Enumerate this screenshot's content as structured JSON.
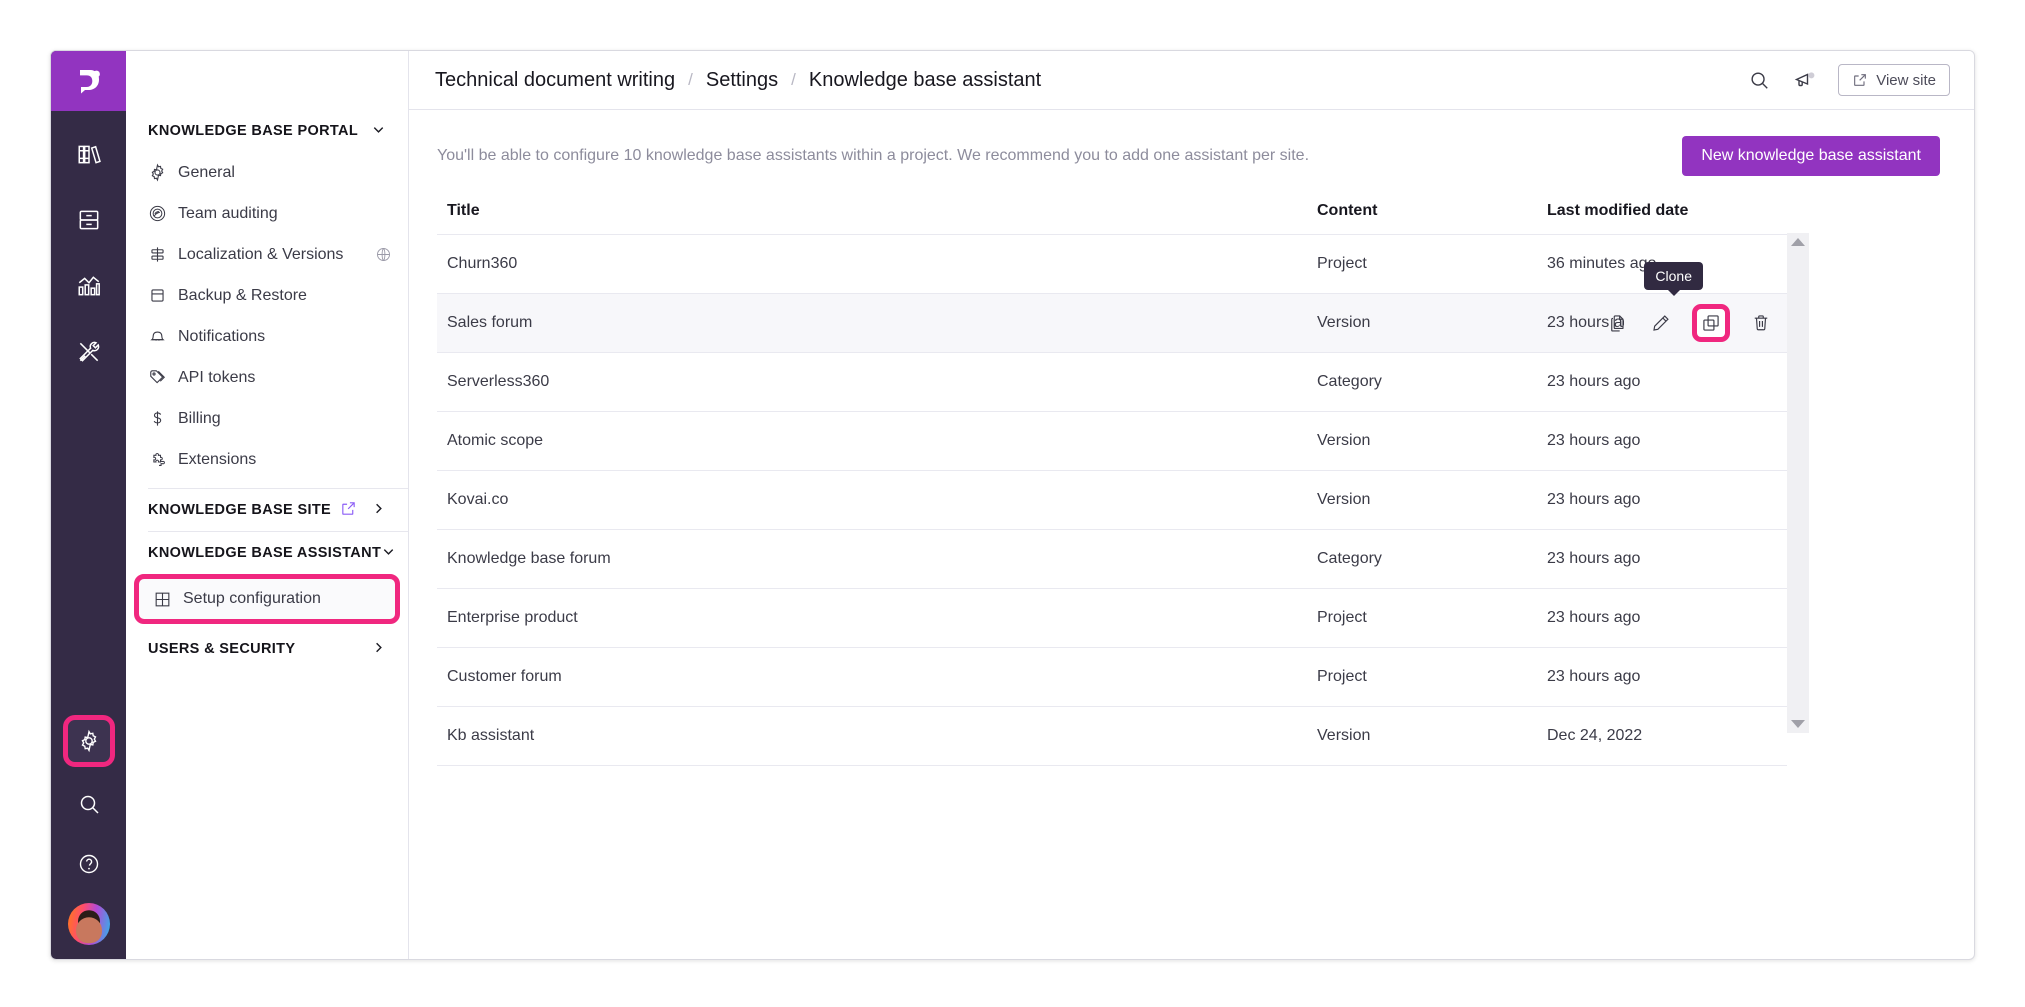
{
  "rail": {
    "logo": "document360-logo",
    "top_icons": [
      {
        "name": "books-icon",
        "title": "Documentation"
      },
      {
        "name": "drawer-icon",
        "title": "Drive"
      },
      {
        "name": "analytics-icon",
        "title": "Analytics"
      },
      {
        "name": "tools-icon",
        "title": "Tools"
      }
    ],
    "bottom_icons": [
      {
        "name": "gear-icon",
        "title": "Settings",
        "highlighted": true
      },
      {
        "name": "search-icon",
        "title": "Search"
      },
      {
        "name": "help-icon",
        "title": "Help"
      }
    ],
    "avatar_label": "User avatar"
  },
  "sidebar": {
    "groups": [
      {
        "label": "KNOWLEDGE BASE PORTAL",
        "chevron": "chevron-down-icon",
        "items": [
          {
            "label": "General",
            "icon": "gear-icon"
          },
          {
            "label": "Team auditing",
            "icon": "audit-icon"
          },
          {
            "label": "Localization & Versions",
            "icon": "localization-icon",
            "trailing": "globe-icon"
          },
          {
            "label": "Backup & Restore",
            "icon": "backup-icon"
          },
          {
            "label": "Notifications",
            "icon": "bell-icon"
          },
          {
            "label": "API tokens",
            "icon": "tag-icon"
          },
          {
            "label": "Billing",
            "icon": "dollar-icon"
          },
          {
            "label": "Extensions",
            "icon": "puzzle-icon"
          }
        ]
      },
      {
        "label": "KNOWLEDGE BASE SITE",
        "chevron": "chevron-right-icon",
        "external": "external-link-icon",
        "items": []
      },
      {
        "label": "KNOWLEDGE BASE ASSISTANT",
        "chevron": "chevron-down-icon",
        "items": [
          {
            "label": "Setup configuration",
            "icon": "grid-icon",
            "highlighted": true
          }
        ]
      },
      {
        "label": "USERS & SECURITY",
        "chevron": "chevron-right-icon",
        "items": []
      }
    ]
  },
  "topbar": {
    "breadcrumb": [
      "Technical document writing",
      "Settings",
      "Knowledge base assistant"
    ],
    "separator": "/",
    "search_icon": "search-icon",
    "announce_icon": "megaphone-icon",
    "view_site_label": "View site",
    "view_site_icon": "external-link-icon"
  },
  "main": {
    "description": "You'll be able to configure 10 knowledge base assistants within a project. We recommend you to add one assistant per site.",
    "new_button_label": "New knowledge base assistant",
    "columns": [
      "Title",
      "Content",
      "Last modified date"
    ],
    "rows": [
      {
        "title": "Churn360",
        "content": "Project",
        "date": "36 minutes ago"
      },
      {
        "title": "Sales forum",
        "content": "Version",
        "date": "23 hours ago",
        "hovered": true
      },
      {
        "title": "Serverless360",
        "content": "Category",
        "date": "23 hours ago"
      },
      {
        "title": "Atomic scope",
        "content": "Version",
        "date": "23 hours ago"
      },
      {
        "title": "Kovai.co",
        "content": "Version",
        "date": "23 hours ago"
      },
      {
        "title": "Knowledge base forum",
        "content": "Category",
        "date": "23 hours ago"
      },
      {
        "title": "Enterprise product",
        "content": "Project",
        "date": "23 hours ago"
      },
      {
        "title": "Customer forum",
        "content": "Project",
        "date": "23 hours ago"
      },
      {
        "title": "Kb assistant",
        "content": "Version",
        "date": "Dec 24, 2022"
      }
    ],
    "row_actions": [
      {
        "name": "copy-icon",
        "label": "Copy"
      },
      {
        "name": "edit-pencil-icon",
        "label": "Edit"
      },
      {
        "name": "clone-icon",
        "label": "Clone",
        "highlighted": true
      },
      {
        "name": "trash-icon",
        "label": "Delete"
      }
    ],
    "tooltip": "Clone"
  },
  "colors": {
    "brand_purple": "#9234c0",
    "rail_dark": "#342b46",
    "highlight_pink": "#f0277f",
    "tooltip_bg": "#312a41"
  }
}
